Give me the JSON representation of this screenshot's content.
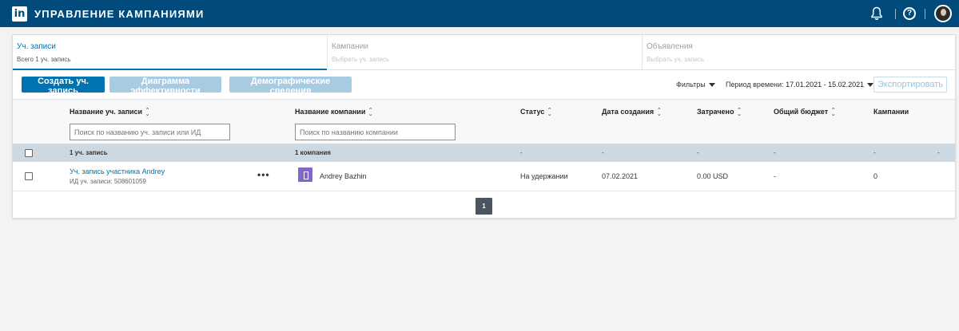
{
  "header": {
    "logo_text": "in",
    "title": "УПРАВЛЕНИЕ КАМПАНИЯМИ",
    "icons": [
      "bell-icon",
      "help-icon",
      "avatar"
    ],
    "colors": {
      "bar": "#004b7c",
      "accent": "#0073b1"
    }
  },
  "tabs": [
    {
      "name": "Уч. записи",
      "sub": "Всего 1 уч. запись",
      "active": true
    },
    {
      "name": "Кампании",
      "sub": "Выбрать уч. запись",
      "active": false
    },
    {
      "name": "Объявления",
      "sub": "Выбрать уч. запись",
      "active": false
    }
  ],
  "toolbar": {
    "create_label": "Создать уч. запись",
    "performance_label": "Диаграмма эффективности",
    "demographics_label": "Демографические сведения",
    "filters_label": "Фильтры",
    "period_label": "Период времени:",
    "period_value": "17.01.2021 - 15.02.2021",
    "export_label": "Экспортировать"
  },
  "table": {
    "columns": {
      "account_name": "Название уч. записи",
      "company_name": "Название компании",
      "status": "Статус",
      "created": "Дата создания",
      "spent": "Затрачено",
      "budget": "Общий бюджет",
      "campaigns": "Кампании"
    },
    "search_account_placeholder": "Поиск по названию уч. записи или ИД",
    "search_company_placeholder": "Поиск по названию компании",
    "summary": {
      "accounts": "1 уч. запись",
      "companies": "1 компания",
      "dash": "-"
    },
    "rows": [
      {
        "account_name": "Уч. запись участника Andrey",
        "account_id": "ИД уч. записи: 508601059",
        "menu": "•••",
        "company": "Andrey Bazhin",
        "status": "На удержании",
        "created": "07.02.2021",
        "spent": "0.00 USD",
        "budget": "-",
        "campaigns": "0"
      }
    ]
  },
  "pagination": {
    "current": "1"
  }
}
